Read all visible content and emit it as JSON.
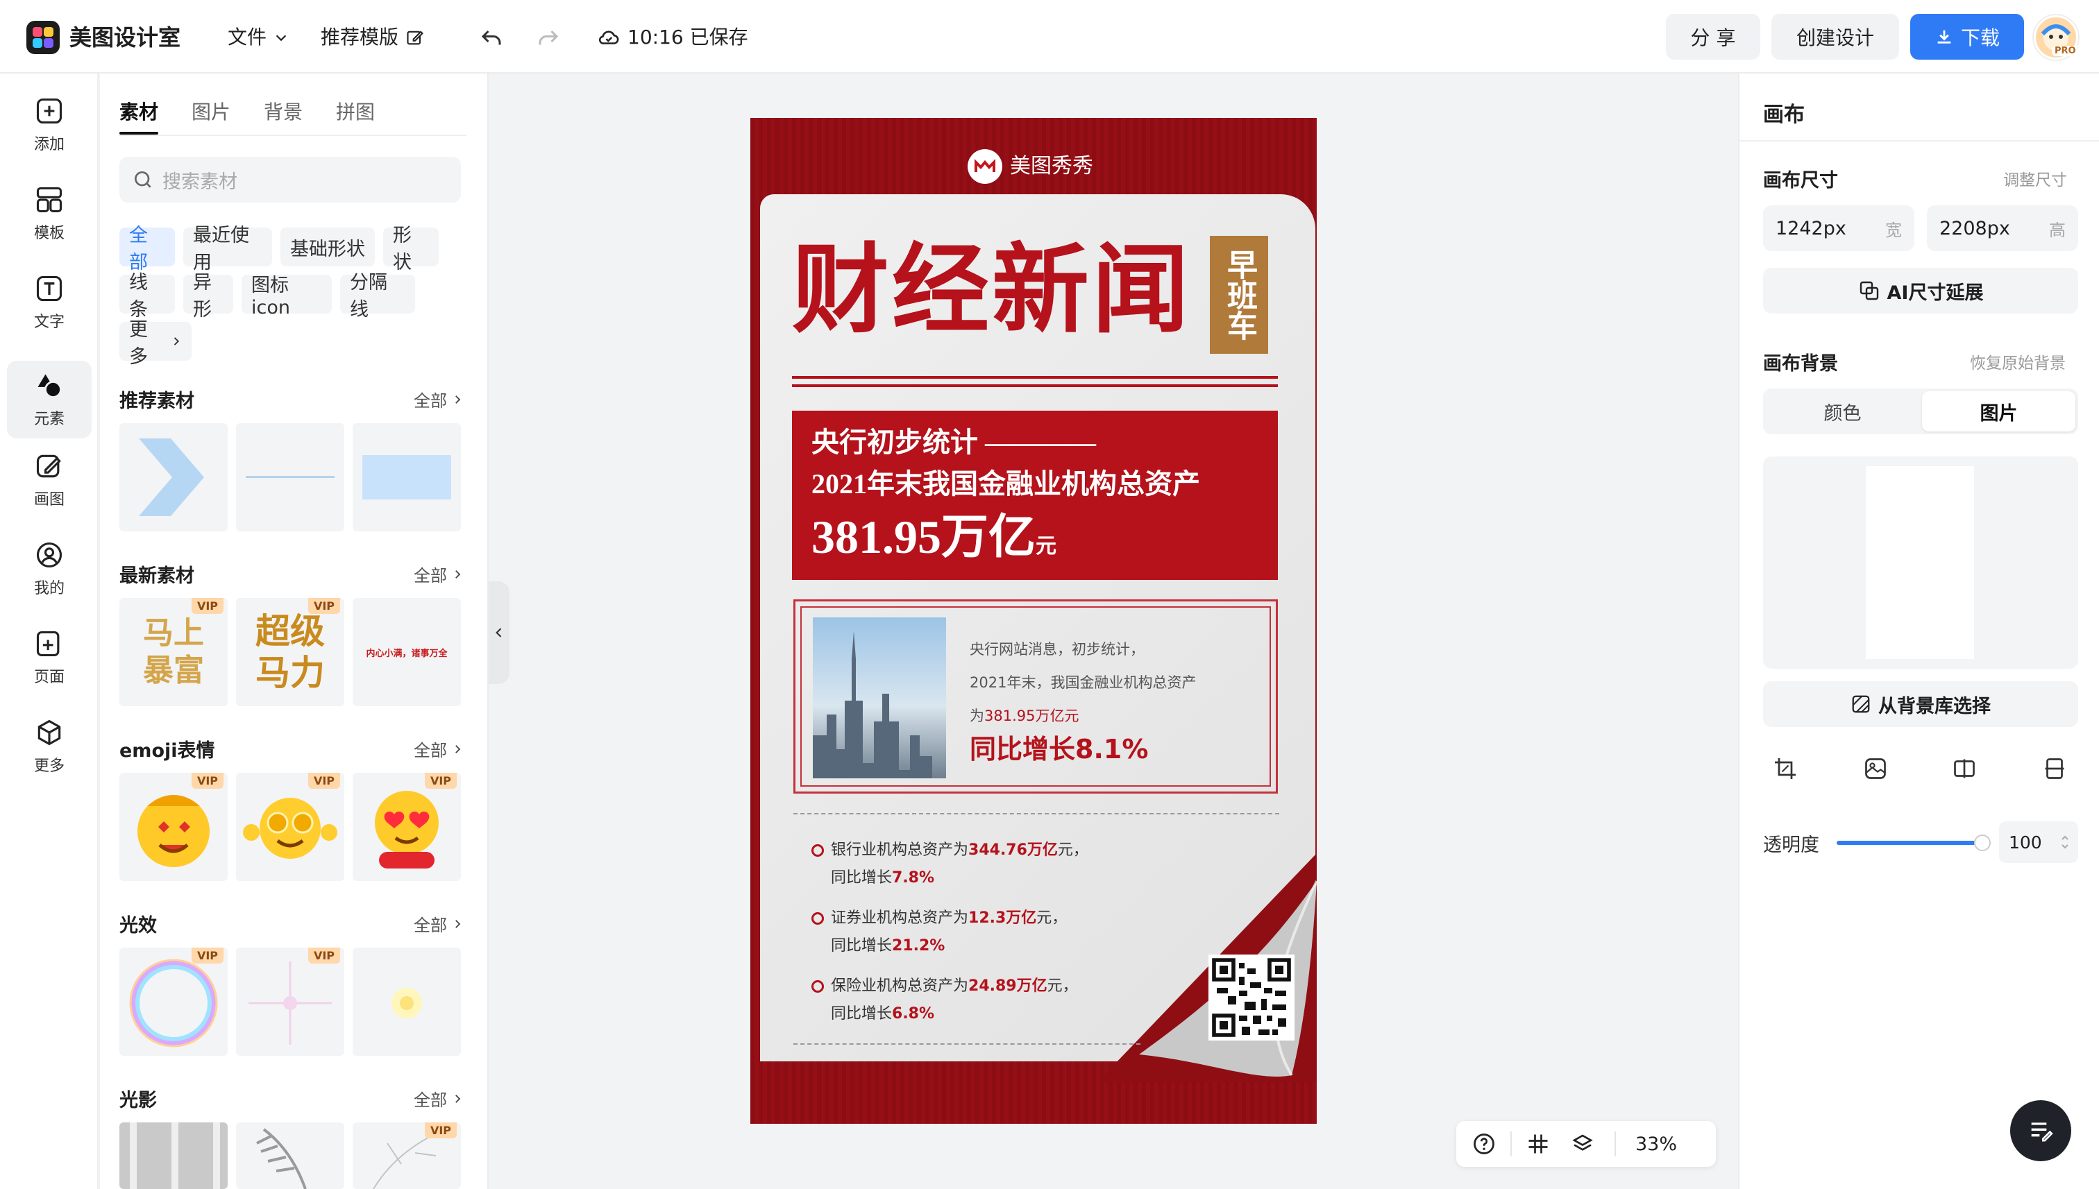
{
  "app": {
    "name": "美图设计室"
  },
  "topbar": {
    "file_menu": "文件",
    "template_menu": "推荐模版",
    "save_status": "10:16 已保存",
    "share": "分 享",
    "create": "创建设计",
    "download": "下载",
    "avatar_badge": "PRO"
  },
  "rail": [
    {
      "label": "添加",
      "icon": "plus-square-icon"
    },
    {
      "label": "模板",
      "icon": "template-grid-icon"
    },
    {
      "label": "文字",
      "icon": "text-icon"
    },
    {
      "label": "元素",
      "icon": "shapes-icon"
    },
    {
      "label": "画图",
      "icon": "draw-icon"
    },
    {
      "label": "我的",
      "icon": "user-icon"
    },
    {
      "label": "页面",
      "icon": "page-add-icon"
    },
    {
      "label": "更多",
      "icon": "cube-icon"
    }
  ],
  "panel": {
    "tabs": [
      "素材",
      "图片",
      "背景",
      "拼图"
    ],
    "search_placeholder": "搜索素材",
    "chips": [
      "全部",
      "最近使用",
      "基础形状",
      "形状",
      "线条",
      "异形",
      "图标icon",
      "分隔线",
      "更多"
    ],
    "see_all": "全部",
    "vip": "VIP",
    "sections": [
      "推荐素材",
      "最新素材",
      "emoji表情",
      "光效",
      "光影"
    ],
    "sticker_texts": [
      "马上暴富",
      "超级马力",
      "内心小满，诸事万全"
    ]
  },
  "poster": {
    "brand": "美图秀秀",
    "title": "财经新闻",
    "tag": "早班车",
    "headline1": "央行初步统计 ————",
    "headline2": "2021年末我国金融业机构总资产",
    "big_number": "381.95万亿",
    "unit": "元",
    "card_line1": "央行网站消息，初步统计，",
    "card_line2": "2021年末，我国金融业机构总资产",
    "card_line3_prefix": "为",
    "card_line3_value": "381.95万亿元",
    "growth": "同比增长8.1%",
    "bullets": [
      {
        "prefix": "银行业机构总资产为",
        "value": "344.76万亿",
        "suffix": "元，",
        "growth_prefix": "同比增长",
        "growth": "7.8%"
      },
      {
        "prefix": "证券业机构总资产为",
        "value": "12.3万亿",
        "suffix": "元，",
        "growth_prefix": "同比增长",
        "growth": "21.2%"
      },
      {
        "prefix": "保险业机构总资产为",
        "value": "24.89万亿",
        "suffix": "元，",
        "growth_prefix": "同比增长",
        "growth": "6.8%"
      }
    ]
  },
  "canvas_toolbar": {
    "zoom": "33%"
  },
  "right": {
    "title": "画布",
    "size_label": "画布尺寸",
    "adjust_size": "调整尺寸",
    "width_value": "1242px",
    "width_unit": "宽",
    "height_value": "2208px",
    "height_unit": "高",
    "ai_extend": "AI尺寸延展",
    "bg_label": "画布背景",
    "restore_bg": "恢复原始背景",
    "seg_color": "颜色",
    "seg_image": "图片",
    "from_library": "从背景库选择",
    "opacity_label": "透明度",
    "opacity_value": "100",
    "opacity_level": 1.0
  },
  "colors": {
    "accent": "#2f7bf5",
    "poster_red": "#a3161e"
  }
}
